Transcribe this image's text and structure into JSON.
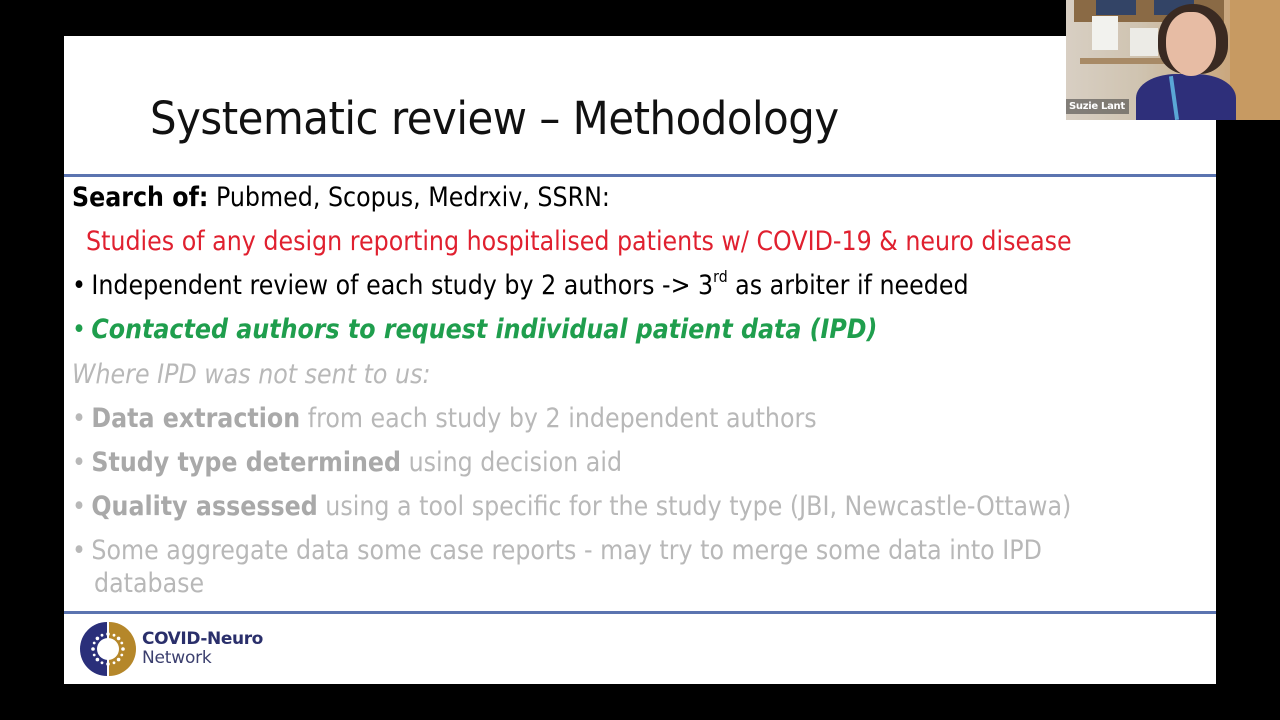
{
  "slide": {
    "title": "Systematic review – Methodology",
    "search": {
      "label": "Search of:",
      "sources": " Pubmed, Scopus, Medrxiv, SSRN:"
    },
    "criteria": "Studies of any design reporting hospitalised patients w/ COVID-19 & neuro disease",
    "bullets_active": [
      {
        "bullet": "•",
        "text_before_sup": "Independent review of each study by 2 authors -> 3",
        "sup": "rd",
        "text_after_sup": " as arbiter if needed"
      },
      {
        "bullet": "•",
        "text": "Contacted authors to request individual patient data (IPD)"
      }
    ],
    "subheading": "Where IPD was not sent to us:",
    "bullets_dimmed": [
      {
        "bullet": "•",
        "bold": "Data extraction",
        "rest": " from each study by 2 independent authors"
      },
      {
        "bullet": "•",
        "bold": "Study type determined",
        "rest": " using decision aid"
      },
      {
        "bullet": "•",
        "bold": "Quality assessed",
        "rest": " using a tool specific for the study type (JBI, Newcastle-Ottawa)"
      },
      {
        "bullet": "•",
        "bold": "",
        "rest": "Some aggregate data some case reports - may try to merge some data into IPD",
        "continuation": "database"
      }
    ],
    "logo": {
      "line1": "COVID-Neuro",
      "line2": "Network",
      "icon": "covid-neuro-network-logo-icon"
    },
    "colors": {
      "accent_rule": "#5b74b0",
      "criteria_red": "#e0202f",
      "highlight_green": "#1f9e4d",
      "dimmed_gray": "#b8b8b8",
      "logo_navy": "#2a2f6b",
      "logo_gold": "#b5872a"
    }
  },
  "video": {
    "participant_name": "Suzie Lant"
  }
}
